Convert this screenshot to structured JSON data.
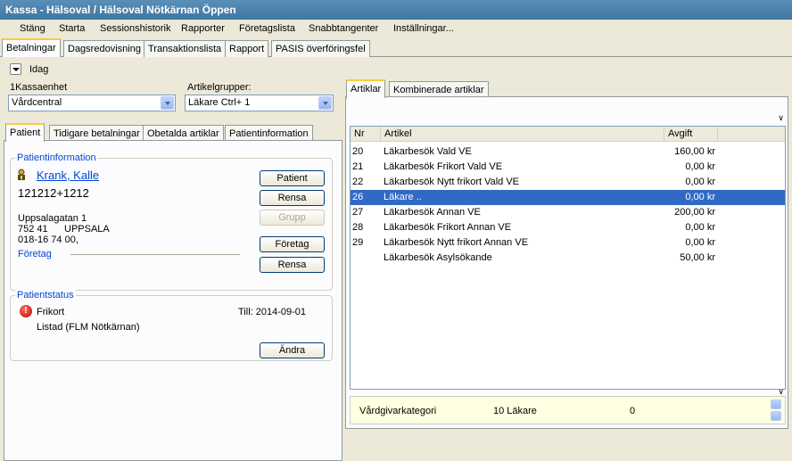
{
  "window": {
    "title": "Kassa - Hälsoval / Hälsoval Nötkärnan Öppen"
  },
  "menu": [
    "Stäng",
    "Starta",
    "Sessionshistorik",
    "Rapporter",
    "Företagslista",
    "Snabbtangenter",
    "Inställningar..."
  ],
  "main_tabs": [
    "Betalningar",
    "Dagsredovisning",
    "Transaktionslista",
    "Rapport",
    "PASIS överföringsfel"
  ],
  "date_toggle": {
    "label": "Idag"
  },
  "kassaenhet": {
    "label": "1Kassaenhet",
    "value": "Vårdcentral"
  },
  "artikelgrupper": {
    "label": "Artikelgrupper:",
    "value": "Läkare Ctrl+ 1"
  },
  "patient_tabs": [
    "Patient",
    "Tidigare betalningar",
    "Obetalda artiklar",
    "Patientinformation"
  ],
  "patientinfo": {
    "title": "Patientinformation",
    "name": "Krank, Kalle",
    "pnr": "121212+1212",
    "address1": "Uppsalagatan 1",
    "postcode": "752 41",
    "city": "UPPSALA",
    "phone": "018-16 74 00,",
    "company_label": "Företag",
    "buttons": {
      "patient": "Patient",
      "rensa1": "Rensa",
      "grupp": "Grupp",
      "foretag": "Företag",
      "rensa2": "Rensa"
    }
  },
  "patientstatus": {
    "title": "Patientstatus",
    "status": "Frikort",
    "until": "Till: 2014-09-01",
    "listed": "Listad (FLM Nötkärnan)",
    "change_button": "Ändra"
  },
  "article_tabs": [
    "Artiklar",
    "Kombinerade artiklar"
  ],
  "articles": {
    "columns": [
      "Nr",
      "Artikel",
      "Avgift"
    ],
    "rows": [
      {
        "nr": "20",
        "name": "Läkarbesök Vald VE",
        "fee": "160,00 kr",
        "selected": false
      },
      {
        "nr": "21",
        "name": "Läkarbesök Frikort Vald VE",
        "fee": "0,00 kr",
        "selected": false
      },
      {
        "nr": "22",
        "name": "Läkarbesök Nytt frikort Vald VE",
        "fee": "0,00 kr",
        "selected": false
      },
      {
        "nr": "26",
        "name": "Läkare ..",
        "fee": "0,00 kr",
        "selected": true
      },
      {
        "nr": "27",
        "name": "Läkarbesök Annan VE",
        "fee": "200,00 kr",
        "selected": false
      },
      {
        "nr": "28",
        "name": "Läkarbesök Frikort Annan VE",
        "fee": "0,00 kr",
        "selected": false
      },
      {
        "nr": "29",
        "name": "Läkarbesök Nytt frikort Annan VE",
        "fee": "0,00 kr",
        "selected": false
      },
      {
        "nr": "",
        "name": "Läkarbesök Asylsökande",
        "fee": "50,00 kr",
        "selected": false
      }
    ]
  },
  "footer": {
    "label": "Vårdgivarkategori",
    "value": "10 Läkare",
    "count": "0"
  },
  "colors": {
    "selection": "#316ac5",
    "title_bar": "#4a82ad",
    "link": "#0046d5",
    "footer_bg": "#ffffe1"
  }
}
